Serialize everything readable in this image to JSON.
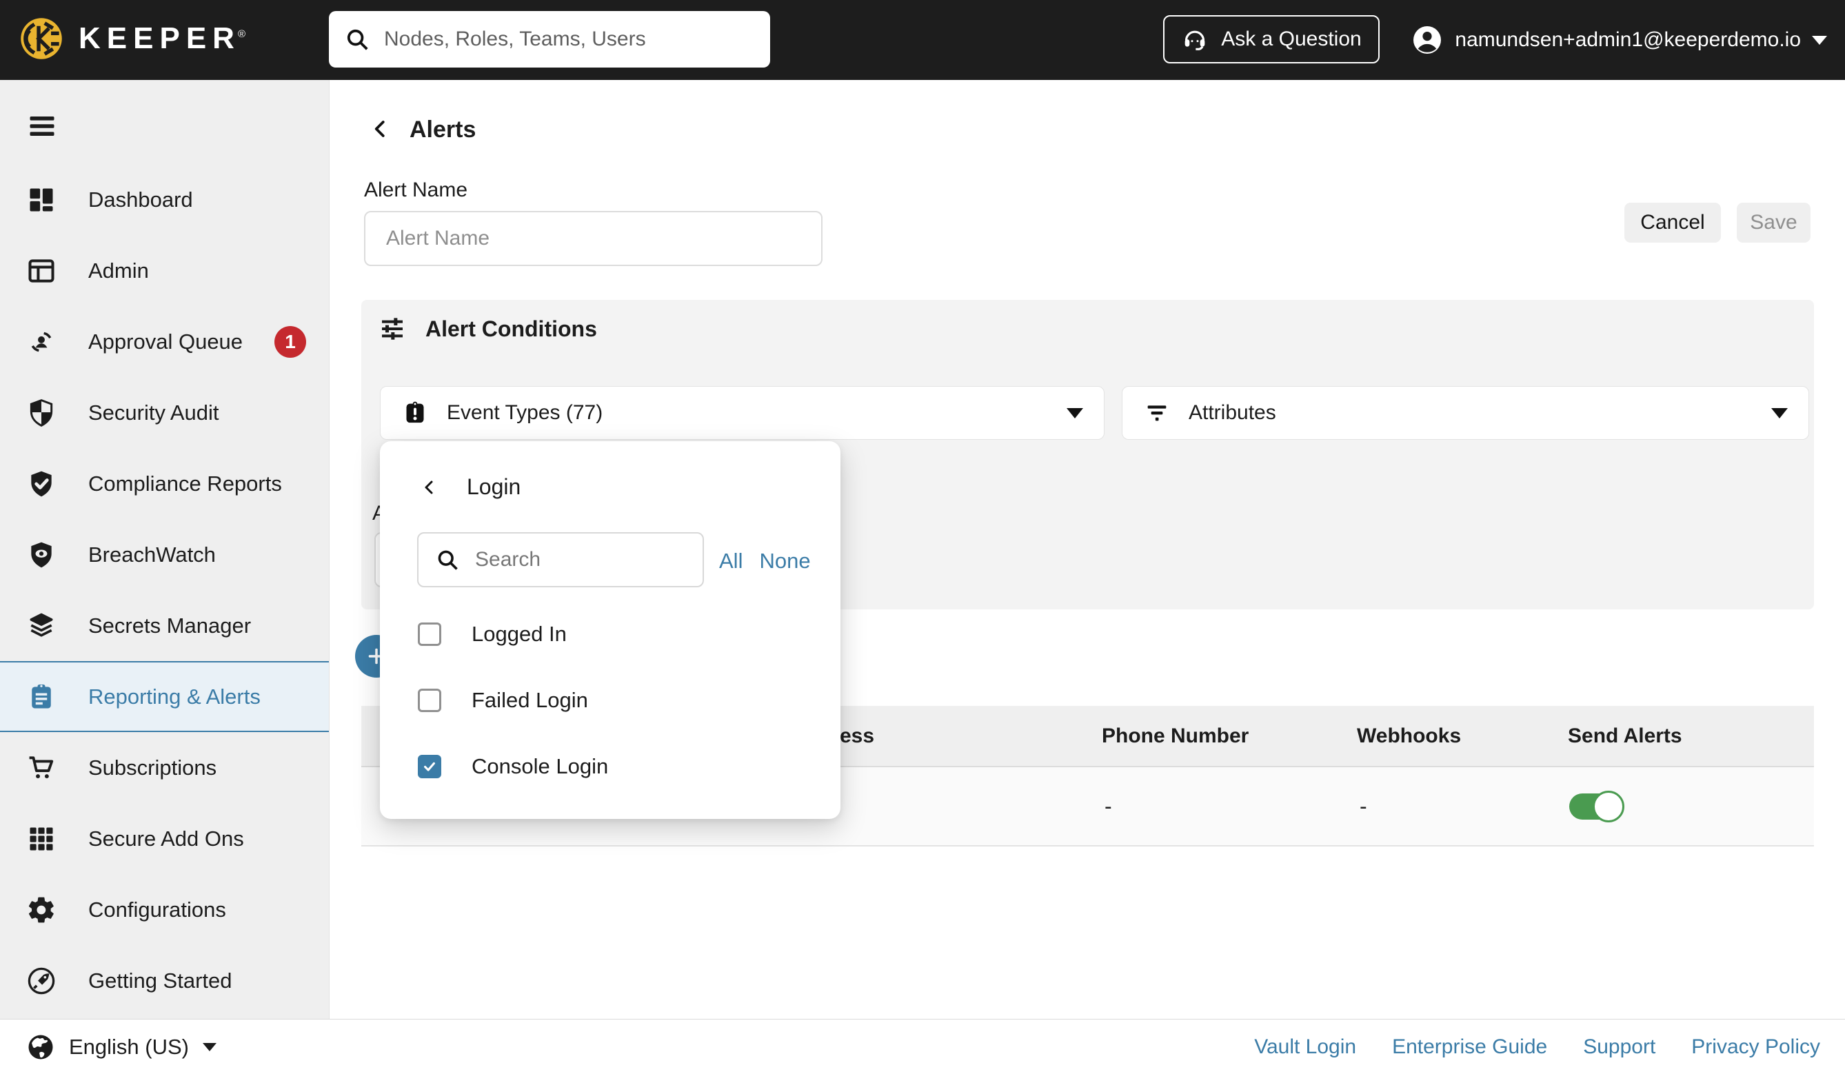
{
  "topbar": {
    "brand": "KEEPER",
    "registered_mark": "®",
    "search_placeholder": "Nodes, Roles, Teams, Users",
    "ask_button_label": "Ask a Question",
    "user_email": "namundsen+admin1@keeperdemo.io",
    "icons": [
      "keeper-logo",
      "search-icon",
      "headset-icon",
      "user-avatar-icon",
      "caret-down-icon"
    ]
  },
  "sidebar": {
    "items": [
      {
        "label": "Dashboard",
        "icon": "dashboard-icon"
      },
      {
        "label": "Admin",
        "icon": "admin-icon"
      },
      {
        "label": "Approval Queue",
        "icon": "approval-queue-icon",
        "badge": "1"
      },
      {
        "label": "Security Audit",
        "icon": "security-audit-icon"
      },
      {
        "label": "Compliance Reports",
        "icon": "compliance-reports-icon"
      },
      {
        "label": "BreachWatch",
        "icon": "breachwatch-icon"
      },
      {
        "label": "Secrets Manager",
        "icon": "secrets-manager-icon"
      },
      {
        "label": "Reporting & Alerts",
        "icon": "reporting-alerts-icon",
        "active": true
      },
      {
        "label": "Subscriptions",
        "icon": "subscriptions-icon"
      },
      {
        "label": "Secure Add Ons",
        "icon": "secure-add-ons-icon"
      },
      {
        "label": "Configurations",
        "icon": "configurations-icon"
      },
      {
        "label": "Getting Started",
        "icon": "getting-started-icon"
      }
    ]
  },
  "page": {
    "back_title": "Alerts",
    "alert_name_label": "Alert Name",
    "alert_name_placeholder": "Alert Name",
    "cancel_label": "Cancel",
    "save_label": "Save",
    "conditions": {
      "title": "Alert Conditions",
      "event_types_label": "Event Types (77)",
      "attributes_label": "Attributes",
      "occluded_label_fragment": "A"
    },
    "dropdown": {
      "title": "Login",
      "search_placeholder": "Search",
      "select_all": "All",
      "select_none": "None",
      "options": [
        {
          "label": "Logged In",
          "checked": false
        },
        {
          "label": "Failed Login",
          "checked": false
        },
        {
          "label": "Console Login",
          "checked": true
        }
      ]
    },
    "recipients_table": {
      "partial_header": "ess",
      "headers": [
        "Phone Number",
        "Webhooks",
        "Send Alerts"
      ],
      "row": {
        "phone_number": "-",
        "webhooks": "-",
        "send_alerts_on": true
      }
    }
  },
  "footer": {
    "language": "English (US)",
    "links": [
      "Vault Login",
      "Enterprise Guide",
      "Support",
      "Privacy Policy"
    ]
  },
  "colors": {
    "accent": "#3b7ca7",
    "topbar_bg": "#1d1d1d",
    "brand_gold": "#e9b42f",
    "badge_red": "#c5292e",
    "toggle_green": "#4a9b50"
  }
}
